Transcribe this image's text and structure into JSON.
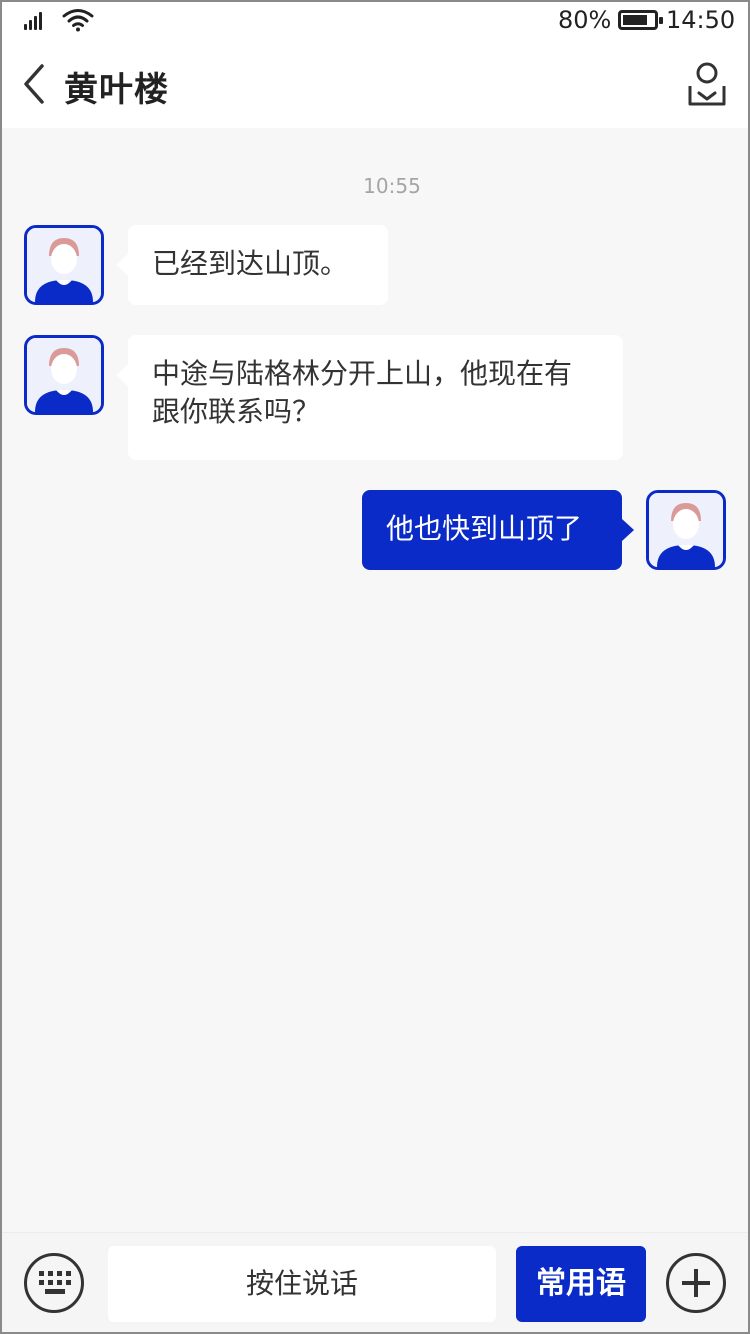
{
  "status_bar": {
    "battery_percent": "80%",
    "battery_level": 0.8,
    "time": "14:50"
  },
  "header": {
    "title": "黄叶楼",
    "back_icon": "chevron-left-icon",
    "profile_icon": "person-icon"
  },
  "chat": {
    "timestamp": "10:55",
    "messages": [
      {
        "direction": "incoming",
        "text": "已经到达山顶。"
      },
      {
        "direction": "incoming",
        "text": "中途与陆格林分开上山，他现在有跟你联系吗？"
      },
      {
        "direction": "outgoing",
        "text": "他也快到山顶了"
      }
    ]
  },
  "input_bar": {
    "keyboard_icon": "keyboard-icon",
    "hold_to_talk_label": "按住说话",
    "common_phrases_label": "常用语",
    "plus_icon": "plus-icon"
  },
  "colors": {
    "accent": "#0a2bc8",
    "background": "#f7f7f7",
    "bubble_incoming": "#ffffff",
    "avatar_hair": "#d99a98"
  }
}
